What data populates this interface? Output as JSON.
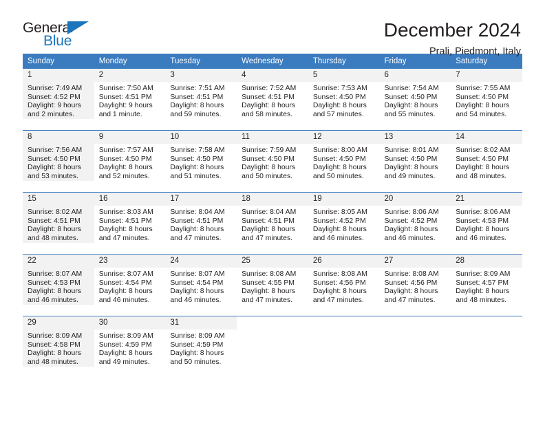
{
  "brand": {
    "name_part1": "General",
    "name_part2": "Blue",
    "accent_color": "#1b75bb",
    "triangle_icon": "triangle-right-icon"
  },
  "header": {
    "title": "December 2024",
    "subtitle": "Prali, Piedmont, Italy"
  },
  "theme": {
    "header_row_bg": "#3b7cc0",
    "daynum_bg": "#f2f2f2",
    "text_color": "#231f20"
  },
  "weekday_headers": [
    "Sunday",
    "Monday",
    "Tuesday",
    "Wednesday",
    "Thursday",
    "Friday",
    "Saturday"
  ],
  "weeks": [
    [
      {
        "day": "1",
        "sunrise": "Sunrise: 7:49 AM",
        "sunset": "Sunset: 4:52 PM",
        "daylight_l1": "Daylight: 9 hours",
        "daylight_l2": "and 2 minutes."
      },
      {
        "day": "2",
        "sunrise": "Sunrise: 7:50 AM",
        "sunset": "Sunset: 4:51 PM",
        "daylight_l1": "Daylight: 9 hours",
        "daylight_l2": "and 1 minute."
      },
      {
        "day": "3",
        "sunrise": "Sunrise: 7:51 AM",
        "sunset": "Sunset: 4:51 PM",
        "daylight_l1": "Daylight: 8 hours",
        "daylight_l2": "and 59 minutes."
      },
      {
        "day": "4",
        "sunrise": "Sunrise: 7:52 AM",
        "sunset": "Sunset: 4:51 PM",
        "daylight_l1": "Daylight: 8 hours",
        "daylight_l2": "and 58 minutes."
      },
      {
        "day": "5",
        "sunrise": "Sunrise: 7:53 AM",
        "sunset": "Sunset: 4:50 PM",
        "daylight_l1": "Daylight: 8 hours",
        "daylight_l2": "and 57 minutes."
      },
      {
        "day": "6",
        "sunrise": "Sunrise: 7:54 AM",
        "sunset": "Sunset: 4:50 PM",
        "daylight_l1": "Daylight: 8 hours",
        "daylight_l2": "and 55 minutes."
      },
      {
        "day": "7",
        "sunrise": "Sunrise: 7:55 AM",
        "sunset": "Sunset: 4:50 PM",
        "daylight_l1": "Daylight: 8 hours",
        "daylight_l2": "and 54 minutes."
      }
    ],
    [
      {
        "day": "8",
        "sunrise": "Sunrise: 7:56 AM",
        "sunset": "Sunset: 4:50 PM",
        "daylight_l1": "Daylight: 8 hours",
        "daylight_l2": "and 53 minutes."
      },
      {
        "day": "9",
        "sunrise": "Sunrise: 7:57 AM",
        "sunset": "Sunset: 4:50 PM",
        "daylight_l1": "Daylight: 8 hours",
        "daylight_l2": "and 52 minutes."
      },
      {
        "day": "10",
        "sunrise": "Sunrise: 7:58 AM",
        "sunset": "Sunset: 4:50 PM",
        "daylight_l1": "Daylight: 8 hours",
        "daylight_l2": "and 51 minutes."
      },
      {
        "day": "11",
        "sunrise": "Sunrise: 7:59 AM",
        "sunset": "Sunset: 4:50 PM",
        "daylight_l1": "Daylight: 8 hours",
        "daylight_l2": "and 50 minutes."
      },
      {
        "day": "12",
        "sunrise": "Sunrise: 8:00 AM",
        "sunset": "Sunset: 4:50 PM",
        "daylight_l1": "Daylight: 8 hours",
        "daylight_l2": "and 50 minutes."
      },
      {
        "day": "13",
        "sunrise": "Sunrise: 8:01 AM",
        "sunset": "Sunset: 4:50 PM",
        "daylight_l1": "Daylight: 8 hours",
        "daylight_l2": "and 49 minutes."
      },
      {
        "day": "14",
        "sunrise": "Sunrise: 8:02 AM",
        "sunset": "Sunset: 4:50 PM",
        "daylight_l1": "Daylight: 8 hours",
        "daylight_l2": "and 48 minutes."
      }
    ],
    [
      {
        "day": "15",
        "sunrise": "Sunrise: 8:02 AM",
        "sunset": "Sunset: 4:51 PM",
        "daylight_l1": "Daylight: 8 hours",
        "daylight_l2": "and 48 minutes."
      },
      {
        "day": "16",
        "sunrise": "Sunrise: 8:03 AM",
        "sunset": "Sunset: 4:51 PM",
        "daylight_l1": "Daylight: 8 hours",
        "daylight_l2": "and 47 minutes."
      },
      {
        "day": "17",
        "sunrise": "Sunrise: 8:04 AM",
        "sunset": "Sunset: 4:51 PM",
        "daylight_l1": "Daylight: 8 hours",
        "daylight_l2": "and 47 minutes."
      },
      {
        "day": "18",
        "sunrise": "Sunrise: 8:04 AM",
        "sunset": "Sunset: 4:51 PM",
        "daylight_l1": "Daylight: 8 hours",
        "daylight_l2": "and 47 minutes."
      },
      {
        "day": "19",
        "sunrise": "Sunrise: 8:05 AM",
        "sunset": "Sunset: 4:52 PM",
        "daylight_l1": "Daylight: 8 hours",
        "daylight_l2": "and 46 minutes."
      },
      {
        "day": "20",
        "sunrise": "Sunrise: 8:06 AM",
        "sunset": "Sunset: 4:52 PM",
        "daylight_l1": "Daylight: 8 hours",
        "daylight_l2": "and 46 minutes."
      },
      {
        "day": "21",
        "sunrise": "Sunrise: 8:06 AM",
        "sunset": "Sunset: 4:53 PM",
        "daylight_l1": "Daylight: 8 hours",
        "daylight_l2": "and 46 minutes."
      }
    ],
    [
      {
        "day": "22",
        "sunrise": "Sunrise: 8:07 AM",
        "sunset": "Sunset: 4:53 PM",
        "daylight_l1": "Daylight: 8 hours",
        "daylight_l2": "and 46 minutes."
      },
      {
        "day": "23",
        "sunrise": "Sunrise: 8:07 AM",
        "sunset": "Sunset: 4:54 PM",
        "daylight_l1": "Daylight: 8 hours",
        "daylight_l2": "and 46 minutes."
      },
      {
        "day": "24",
        "sunrise": "Sunrise: 8:07 AM",
        "sunset": "Sunset: 4:54 PM",
        "daylight_l1": "Daylight: 8 hours",
        "daylight_l2": "and 46 minutes."
      },
      {
        "day": "25",
        "sunrise": "Sunrise: 8:08 AM",
        "sunset": "Sunset: 4:55 PM",
        "daylight_l1": "Daylight: 8 hours",
        "daylight_l2": "and 47 minutes."
      },
      {
        "day": "26",
        "sunrise": "Sunrise: 8:08 AM",
        "sunset": "Sunset: 4:56 PM",
        "daylight_l1": "Daylight: 8 hours",
        "daylight_l2": "and 47 minutes."
      },
      {
        "day": "27",
        "sunrise": "Sunrise: 8:08 AM",
        "sunset": "Sunset: 4:56 PM",
        "daylight_l1": "Daylight: 8 hours",
        "daylight_l2": "and 47 minutes."
      },
      {
        "day": "28",
        "sunrise": "Sunrise: 8:09 AM",
        "sunset": "Sunset: 4:57 PM",
        "daylight_l1": "Daylight: 8 hours",
        "daylight_l2": "and 48 minutes."
      }
    ],
    [
      {
        "day": "29",
        "sunrise": "Sunrise: 8:09 AM",
        "sunset": "Sunset: 4:58 PM",
        "daylight_l1": "Daylight: 8 hours",
        "daylight_l2": "and 48 minutes."
      },
      {
        "day": "30",
        "sunrise": "Sunrise: 8:09 AM",
        "sunset": "Sunset: 4:59 PM",
        "daylight_l1": "Daylight: 8 hours",
        "daylight_l2": "and 49 minutes."
      },
      {
        "day": "31",
        "sunrise": "Sunrise: 8:09 AM",
        "sunset": "Sunset: 4:59 PM",
        "daylight_l1": "Daylight: 8 hours",
        "daylight_l2": "and 50 minutes."
      },
      {
        "day": "",
        "sunrise": "",
        "sunset": "",
        "daylight_l1": "",
        "daylight_l2": ""
      },
      {
        "day": "",
        "sunrise": "",
        "sunset": "",
        "daylight_l1": "",
        "daylight_l2": ""
      },
      {
        "day": "",
        "sunrise": "",
        "sunset": "",
        "daylight_l1": "",
        "daylight_l2": ""
      },
      {
        "day": "",
        "sunrise": "",
        "sunset": "",
        "daylight_l1": "",
        "daylight_l2": ""
      }
    ]
  ]
}
